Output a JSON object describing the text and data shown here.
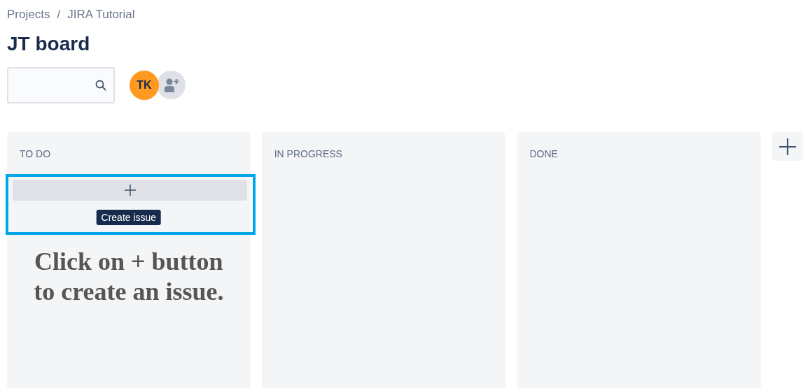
{
  "breadcrumbs": [
    "Projects",
    "JIRA Tutorial"
  ],
  "breadcrumb_separator": "/",
  "title": "JT board",
  "avatars": [
    {
      "kind": "initials",
      "initials": "TK",
      "color": "#ff991f"
    },
    {
      "kind": "add-person"
    }
  ],
  "columns": [
    {
      "title": "TO DO",
      "create_tooltip": "Create issue",
      "annotation": "Click on + button to create an issue."
    },
    {
      "title": "IN PROGRESS"
    },
    {
      "title": "DONE"
    }
  ]
}
